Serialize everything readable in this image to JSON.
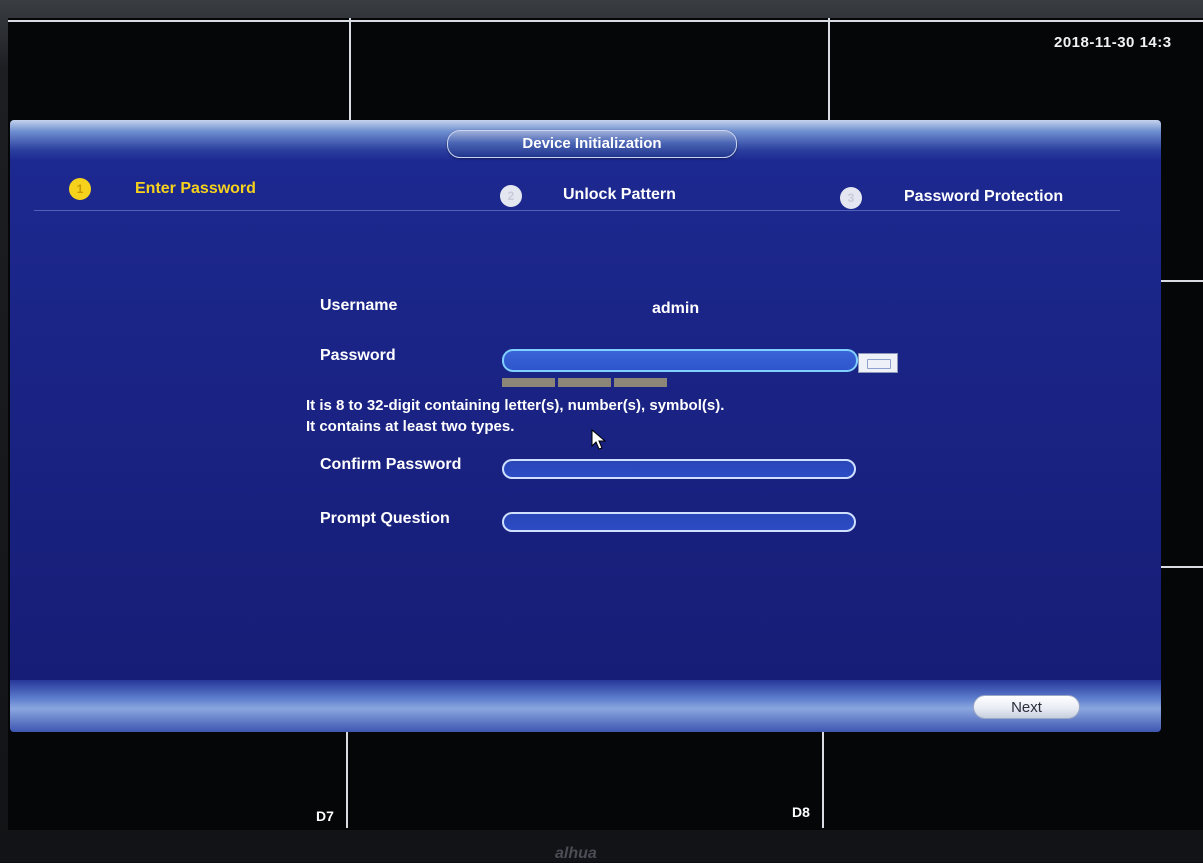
{
  "screen": {
    "timestamp": "2018-11-30 14:3",
    "channels": [
      "D7",
      "D8"
    ],
    "brand": "alhua"
  },
  "dialog": {
    "title": "Device Initialization",
    "steps": [
      {
        "number": "1",
        "label": "Enter Password",
        "state": "active"
      },
      {
        "number": "2",
        "label": "Unlock Pattern",
        "state": "inactive"
      },
      {
        "number": "3",
        "label": "Password Protection",
        "state": "inactive"
      }
    ],
    "form": {
      "username_label": "Username",
      "username_value": "admin",
      "password_label": "Password",
      "password_value": "",
      "hint_line1": "It is 8 to 32-digit containing letter(s), number(s), symbol(s).",
      "hint_line2": "It contains at least two types.",
      "confirm_label": "Confirm Password",
      "confirm_value": "",
      "prompt_label": "Prompt Question",
      "prompt_value": ""
    },
    "next_label": "Next"
  },
  "colors": {
    "dialog_bg": "#1a2384",
    "active_step": "#f7d21d",
    "field_border": "#cfe0ff"
  },
  "icons": [
    "keyboard-icon",
    "mouse-cursor-icon"
  ]
}
